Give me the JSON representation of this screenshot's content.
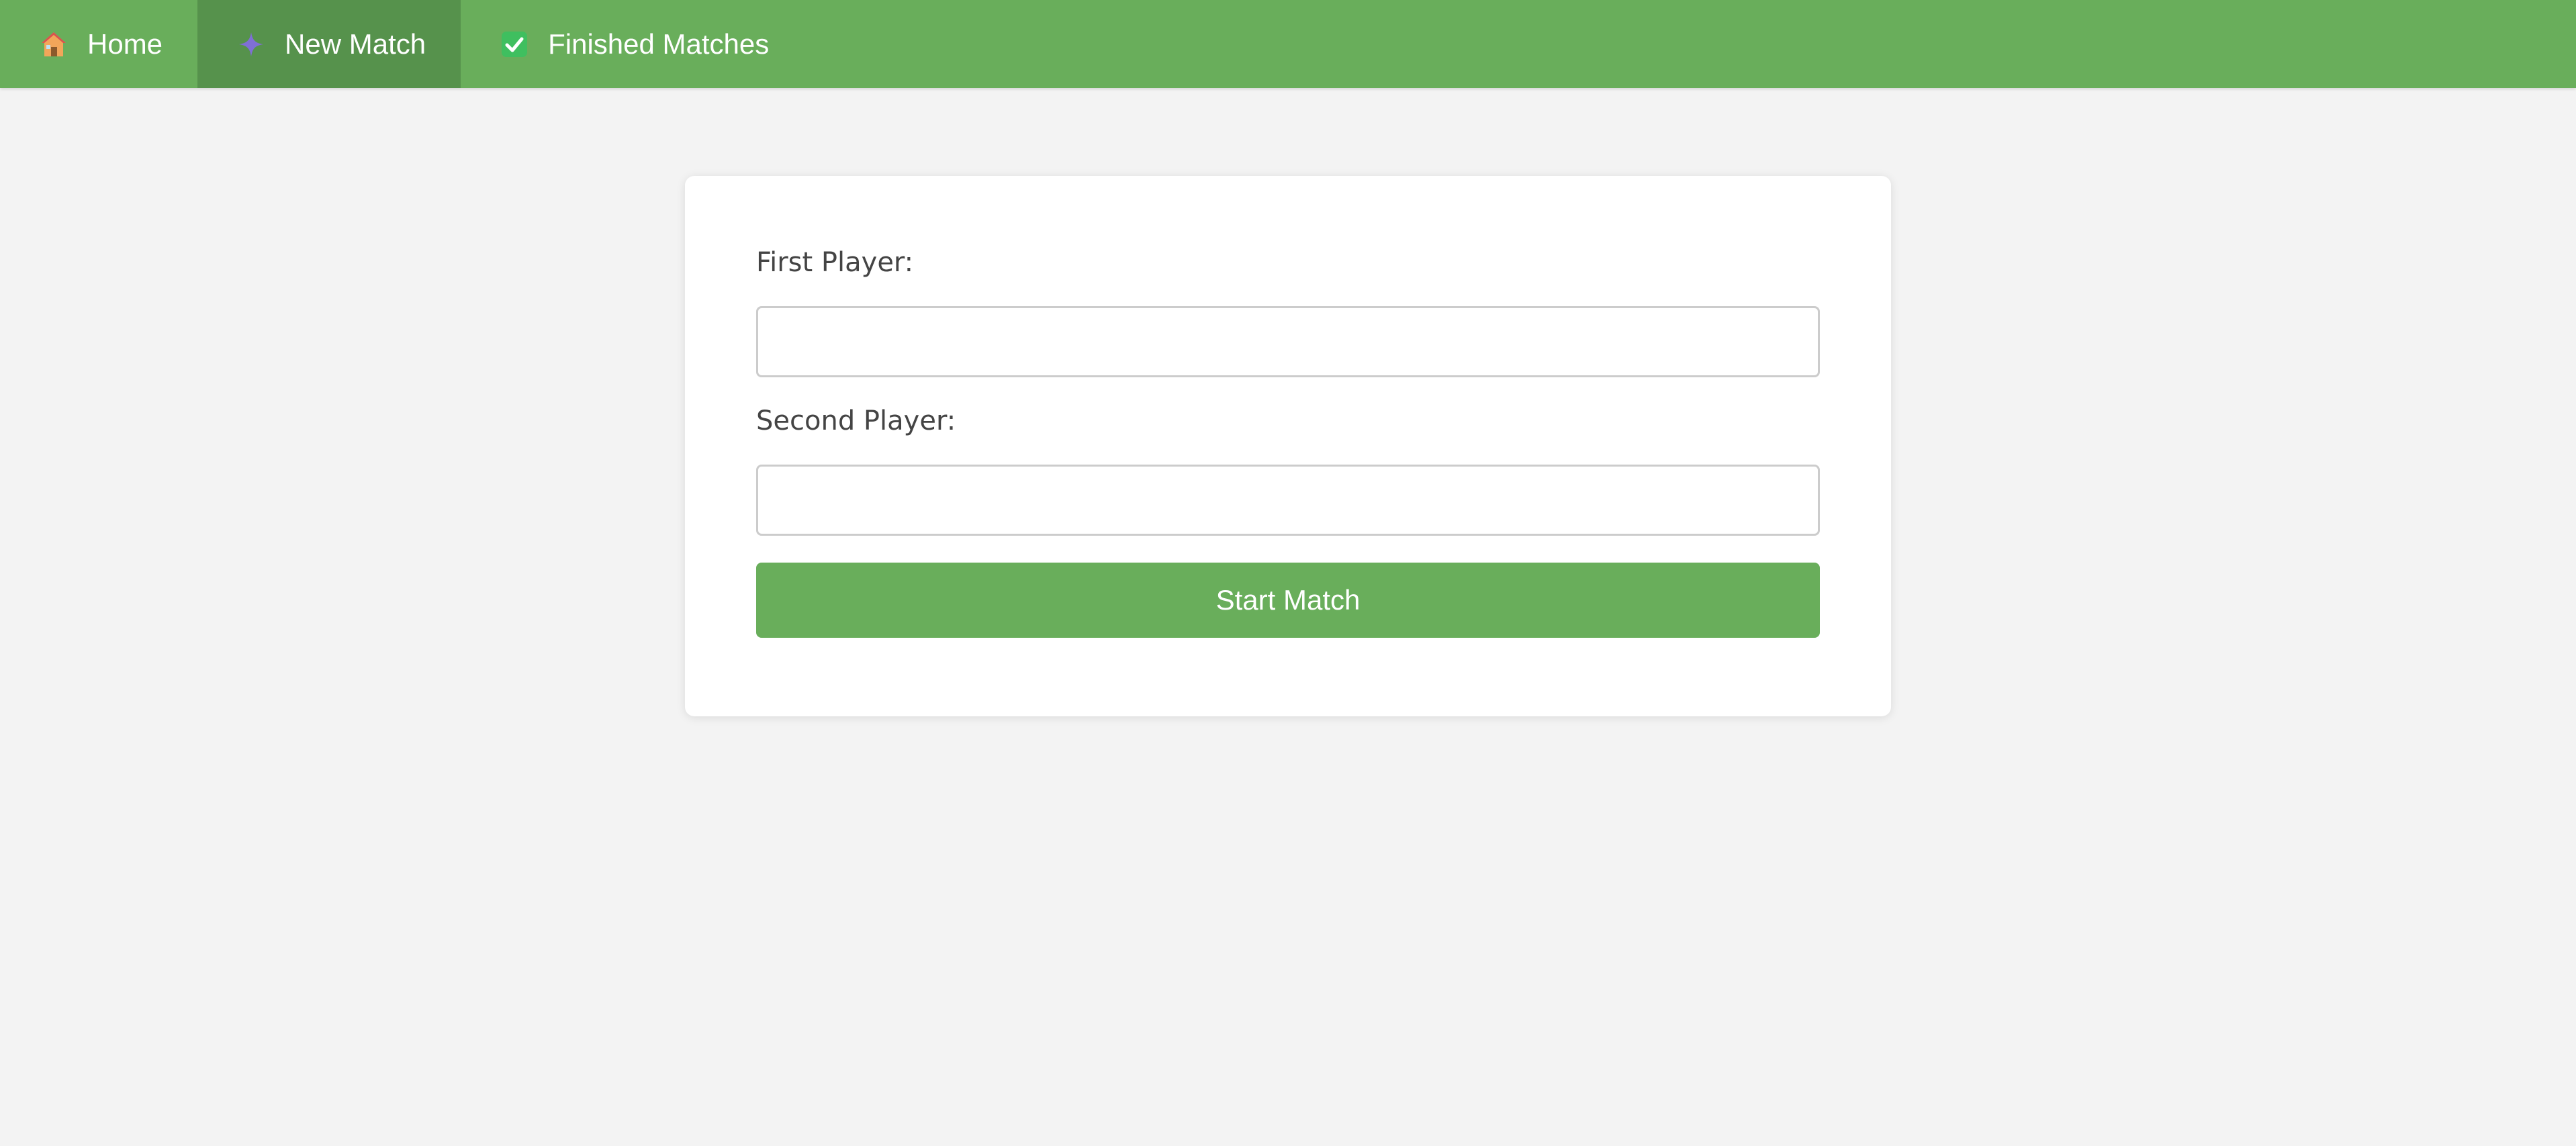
{
  "nav": {
    "items": [
      {
        "label": "Home",
        "icon": "house-icon"
      },
      {
        "label": "New Match",
        "icon": "sparkle-icon"
      },
      {
        "label": "Finished Matches",
        "icon": "check-mark-icon"
      }
    ],
    "active_index": 1
  },
  "form": {
    "first_player": {
      "label": "First Player:",
      "value": "",
      "placeholder": ""
    },
    "second_player": {
      "label": "Second Player:",
      "value": "",
      "placeholder": ""
    },
    "submit_label": "Start Match"
  },
  "colors": {
    "navbar": "#69ae5b",
    "navbar_active": "#56924c",
    "page_background": "#f3f3f3",
    "card_background": "#ffffff",
    "button": "#69ae5b"
  }
}
